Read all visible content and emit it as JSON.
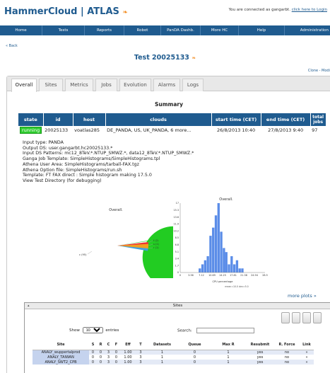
{
  "header": {
    "brand": "HammerCloud | ATLAS",
    "rss_glyph": "❧",
    "connection_text": "You are connected as gangarbt.",
    "login_link": "click here to Login"
  },
  "nav": {
    "items": [
      "Home",
      "Tests",
      "Reports",
      "Robot",
      "PanDA Dashb.",
      "More HC",
      "Help",
      "Administration"
    ]
  },
  "back_link": "« Back",
  "test_title": "Test 20025133",
  "clone_link": "Clone - Modi",
  "tabs": [
    "Overall",
    "Sites",
    "Metrics",
    "Jobs",
    "Evolution",
    "Alarms",
    "Logs"
  ],
  "summary": {
    "title": "Summary",
    "columns": [
      "state",
      "id",
      "host",
      "clouds",
      "start time (CET)",
      "end time (CET)",
      "total jobs"
    ],
    "row": {
      "state": "running",
      "id": "20025133",
      "host": "voatlas285",
      "clouds": "DE_PANDA, US, UK_PANDA, 6 more...",
      "start": "26/8/2013 10:40",
      "end": "27/8/2013 9:40",
      "total": "97"
    }
  },
  "info_lines": [
    "Input type: PANDA",
    "Output DS: user.gangarbt.hc20025133.*",
    "Input DS Patterns: mc12_8TeV.*.NTUP_SMWZ.*, data12_8TeV.*.NTUP_SMWZ.*",
    "Ganga Job Template: SimpleHistograms/SimpleHistograms.tpl",
    "Athena User Area: SimpleHistograms/tarball-FAX.tgz",
    "Athena Option file: SimpleHistograms/run.sh",
    "Template: FT FAX direct : Simple histogram making 17.5.0",
    "View Test Directory (for debugging)"
  ],
  "pie_chart": {
    "title": "Overall.",
    "labels": [
      "c (95)",
      "f (2)",
      "s (1)",
      "r (1)"
    ],
    "colors": {
      "c": "#22cc22",
      "f": "#ee3333",
      "s": "#f0a020",
      "r": "#40a0e0"
    }
  },
  "histogram": {
    "title": "Overall.",
    "xlabel": "CPU percentage",
    "stats": "mean=10.0 dev=5.0",
    "y_ticks": [
      "0",
      "1.7",
      "3.4",
      "5.1",
      "6.8",
      "8.5",
      "10.2",
      "11.9",
      "13.6",
      "15.3",
      "17"
    ],
    "x_ticks": [
      "0",
      "3.56",
      "7.12",
      "10.69",
      "14.25",
      "17.81",
      "21.38",
      "24.94",
      "28.5"
    ]
  },
  "chart_data": {
    "type": "bar",
    "title": "Overall.",
    "xlabel": "CPU percentage",
    "ylabel": "",
    "ylim": [
      0,
      17
    ],
    "xlim": [
      0,
      28.5
    ],
    "bin_width": 0.89,
    "x": [
      6.2,
      7.1,
      8.0,
      8.9,
      9.8,
      10.7,
      11.6,
      12.5,
      13.4,
      14.3,
      15.1,
      16.0,
      16.9,
      17.8,
      18.7,
      19.6,
      20.5
    ],
    "values": [
      1,
      2,
      3,
      4,
      9,
      11,
      14,
      17,
      10,
      6,
      5,
      2,
      4,
      2,
      3,
      1,
      1
    ]
  },
  "more_plots": "more plots »",
  "sites": {
    "title": "Sites",
    "toggle": "▴",
    "show_label": "Show",
    "show_value": "10",
    "entries_label": "entries",
    "search_label": "Search:",
    "columns": [
      "Site",
      "S",
      "R",
      "C",
      "F",
      "Eff",
      "T",
      "Datasets",
      "Queue",
      "Max R",
      "Resubmit",
      "R. Force",
      "Link"
    ],
    "rows": [
      [
        "ANALY_wuppertalprod",
        "0",
        "0",
        "3",
        "0",
        "1.00",
        "3",
        "1",
        "0",
        "1",
        "yes",
        "no",
        "»"
      ],
      [
        "ANALY_TAIWAN",
        "0",
        "0",
        "3",
        "0",
        "1.00",
        "3",
        "1",
        "0",
        "1",
        "yes",
        "no",
        "»"
      ],
      [
        "ANALY_SWT2_CPB",
        "0",
        "0",
        "3",
        "0",
        "1.00",
        "3",
        "1",
        "0",
        "1",
        "yes",
        "no",
        "»"
      ]
    ]
  }
}
